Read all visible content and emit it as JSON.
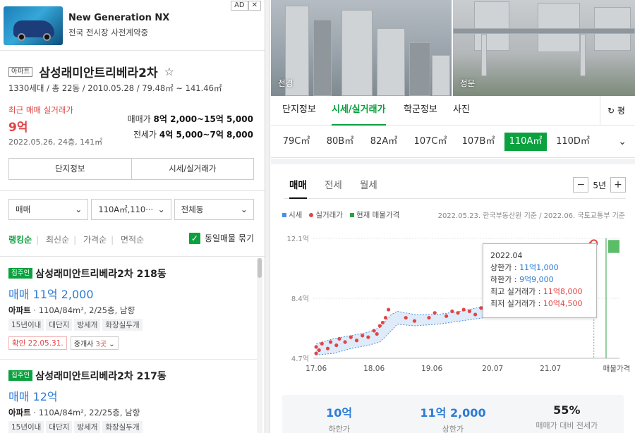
{
  "ad": {
    "title": "New Generation NX",
    "subtitle": "전국 전시장 사전계약중",
    "ad_label": "AD",
    "close_label": "✕"
  },
  "complex": {
    "type_tag": "아파트",
    "name": "삼성래미안트리베라2차",
    "star": "☆",
    "info": "1330세대 / 총 22동 / 2010.05.28 / 79.48㎡ ~ 141.46㎡",
    "recent_label": "최근 매매 실거래가",
    "recent_price": "9억",
    "recent_date": "2022.05.26, 24층, 141㎡",
    "sale_label": "매매가",
    "sale_range": "8억 2,000~15억 5,000",
    "jeonse_label": "전세가",
    "jeonse_range": "4억 5,000~7억 8,000"
  },
  "left_tabs": [
    "단지정보",
    "시세/실거래가"
  ],
  "filters": [
    {
      "label": "매매",
      "icon": "chevron-down-icon"
    },
    {
      "label": "110A㎡,110···",
      "icon": "chevron-down-icon"
    },
    {
      "label": "전체동",
      "icon": "chevron-down-icon"
    }
  ],
  "sort": {
    "items": [
      "랭킹순",
      "최신순",
      "가격순",
      "면적순"
    ],
    "group_label": "동일매물 묶기",
    "check": "✓"
  },
  "listings": [
    {
      "badge": "집주인",
      "name": "삼성래미안트리베라2차 218동",
      "price": "매매 11억 2,000",
      "type": "아파트",
      "desc": "· 110A/84m², 2/25층, 남향",
      "tags": [
        "15년이내",
        "대단지",
        "방세개",
        "화장실두개"
      ],
      "confirm": "확인 22.05.31.",
      "agent_prefix": "중개사 ",
      "agent_count": "3곳"
    },
    {
      "badge": "집주인",
      "name": "삼성래미안트리베라2차 217동",
      "price": "매매 12억",
      "type": "아파트",
      "desc": "· 110A/84m², 22/25층, 남향",
      "tags": [
        "15년이내",
        "대단지",
        "방세개",
        "화장실두개"
      ]
    }
  ],
  "photos": [
    {
      "label": "전경"
    },
    {
      "label": "정문"
    }
  ],
  "main_tabs": [
    "단지정보",
    "시세/실거래가",
    "학군정보",
    "사진"
  ],
  "reload_label": "↻ 평",
  "area_tabs": [
    "79C㎡",
    "80B㎡",
    "82A㎡",
    "107C㎡",
    "107B㎡",
    "110A㎡",
    "110D㎡"
  ],
  "area_active": "110A㎡",
  "trade_tabs": [
    "매매",
    "전세",
    "월세"
  ],
  "period": {
    "minus": "−",
    "value": "5년",
    "plus": "+"
  },
  "legend": {
    "items": [
      {
        "label": "시세",
        "color": "#4a90e2"
      },
      {
        "label": "실거래가",
        "color": "#e24545"
      },
      {
        "label": "현재 매물가격",
        "color": "#2ea043"
      }
    ],
    "source": "2022.05.23. 한국부동산원 기준 / 2022.06. 국토교통부 기준"
  },
  "chart_data": {
    "type": "line",
    "x_ticks": [
      "17.06",
      "18.06",
      "19.06",
      "20.07",
      "21.07",
      "매물가격"
    ],
    "y_ticks": [
      "12.1억",
      "8.4억",
      "4.7억"
    ],
    "ylim": [
      4.7,
      12.1
    ],
    "band_upper": [
      [
        2017.5,
        5.6
      ],
      [
        2017.8,
        5.9
      ],
      [
        2018.1,
        6.1
      ],
      [
        2018.4,
        6.3
      ],
      [
        2018.6,
        6.6
      ],
      [
        2018.8,
        7.4
      ],
      [
        2018.9,
        7.6
      ],
      [
        2019.2,
        7.4
      ],
      [
        2019.6,
        7.4
      ],
      [
        2020.0,
        7.6
      ],
      [
        2020.4,
        7.9
      ],
      [
        2020.8,
        8.2
      ],
      [
        2021.1,
        8.7
      ],
      [
        2021.3,
        9.3
      ],
      [
        2021.5,
        9.9
      ],
      [
        2021.7,
        10.6
      ],
      [
        2021.9,
        11.0
      ],
      [
        2022.1,
        11.2
      ],
      [
        2022.3,
        11.1
      ]
    ],
    "band_lower": [
      [
        2017.5,
        4.9
      ],
      [
        2017.8,
        5.0
      ],
      [
        2018.1,
        5.3
      ],
      [
        2018.4,
        5.5
      ],
      [
        2018.6,
        5.7
      ],
      [
        2018.8,
        6.4
      ],
      [
        2018.9,
        6.8
      ],
      [
        2019.2,
        6.7
      ],
      [
        2019.6,
        6.8
      ],
      [
        2020.0,
        7.0
      ],
      [
        2020.4,
        7.2
      ],
      [
        2020.8,
        7.5
      ],
      [
        2021.1,
        8.0
      ],
      [
        2021.3,
        8.5
      ],
      [
        2021.5,
        9.0
      ],
      [
        2021.7,
        9.6
      ],
      [
        2021.9,
        9.9
      ],
      [
        2022.1,
        10.0
      ],
      [
        2022.3,
        10.0
      ]
    ],
    "trades": [
      [
        2017.5,
        5.0
      ],
      [
        2017.5,
        5.4
      ],
      [
        2017.55,
        5.2
      ],
      [
        2017.6,
        5.6
      ],
      [
        2017.7,
        5.3
      ],
      [
        2017.75,
        5.7
      ],
      [
        2017.85,
        5.5
      ],
      [
        2017.9,
        5.9
      ],
      [
        2018.0,
        5.7
      ],
      [
        2018.1,
        6.0
      ],
      [
        2018.2,
        5.8
      ],
      [
        2018.3,
        6.1
      ],
      [
        2018.4,
        6.0
      ],
      [
        2018.5,
        6.4
      ],
      [
        2018.55,
        6.2
      ],
      [
        2018.6,
        6.7
      ],
      [
        2018.65,
        6.9
      ],
      [
        2018.7,
        7.2
      ],
      [
        2018.75,
        7.7
      ],
      [
        2019.05,
        7.2
      ],
      [
        2019.2,
        7.0
      ],
      [
        2019.45,
        7.2
      ],
      [
        2019.55,
        7.5
      ],
      [
        2019.75,
        7.3
      ],
      [
        2019.85,
        7.6
      ],
      [
        2019.95,
        7.5
      ],
      [
        2020.05,
        7.7
      ],
      [
        2020.15,
        7.6
      ],
      [
        2020.25,
        7.4
      ],
      [
        2020.35,
        7.8
      ],
      [
        2020.45,
        8.0
      ],
      [
        2020.55,
        8.2
      ],
      [
        2021.45,
        10.2
      ],
      [
        2021.55,
        10.5
      ],
      [
        2021.65,
        10.8
      ],
      [
        2021.75,
        11.3
      ],
      [
        2021.85,
        11.5
      ],
      [
        2021.9,
        10.9
      ],
      [
        2022.1,
        11.2
      ],
      [
        2022.2,
        10.8
      ],
      [
        2022.25,
        11.8
      ]
    ],
    "highlight": [
      2022.3,
      11.8
    ],
    "listing_range": [
      11.2,
      12.0
    ],
    "tooltip": {
      "date": "2022.04",
      "upper_label": "상한가 : ",
      "upper": "11억1,000",
      "lower_label": "하한가 : ",
      "lower": "9억9,000",
      "max_label": "최고 실거래가 : ",
      "max": "11억8,000",
      "min_label": "최저 실거래가 : ",
      "min": "10억4,500"
    }
  },
  "summary": [
    {
      "value": "10억",
      "label": "하한가",
      "color": "blue"
    },
    {
      "value": "11억 2,000",
      "label": "상한가",
      "color": "blue"
    },
    {
      "value": "55%",
      "label": "매매가 대비 전세가",
      "color": "black"
    }
  ]
}
